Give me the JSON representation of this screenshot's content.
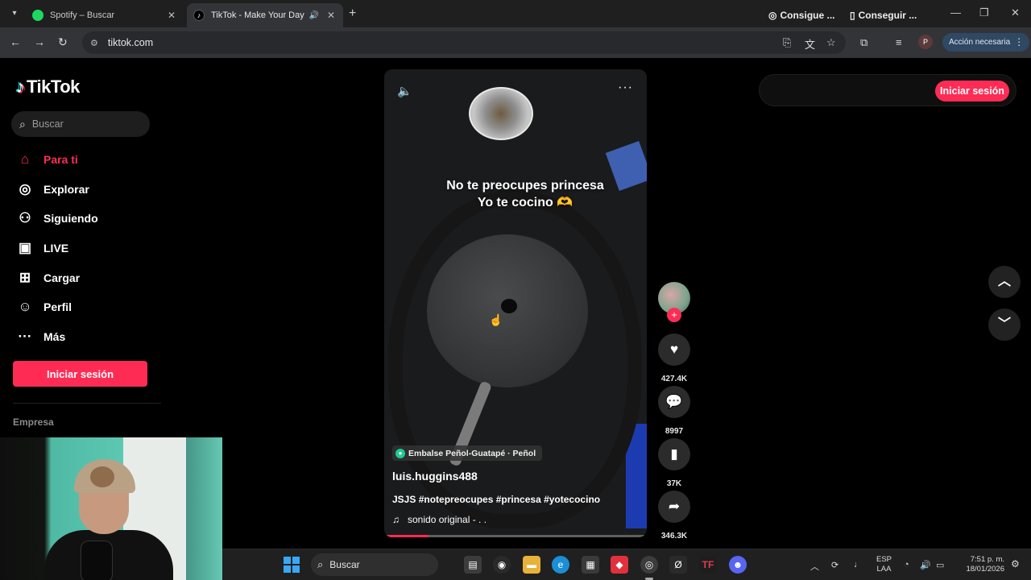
{
  "browser": {
    "tabs": [
      {
        "title": "Spotify – Buscar",
        "active": false
      },
      {
        "title": "TikTok - Make Your Day",
        "active": true,
        "audio": true
      }
    ],
    "url": "tiktok.com",
    "action_button": "Acción necesaria",
    "profile_initial": "P"
  },
  "sidebar": {
    "logo": "TikTok",
    "search_placeholder": "Buscar",
    "nav": [
      {
        "label": "Para ti",
        "icon": "home-icon",
        "active": true
      },
      {
        "label": "Explorar",
        "icon": "compass-icon"
      },
      {
        "label": "Siguiendo",
        "icon": "following-icon"
      },
      {
        "label": "LIVE",
        "icon": "live-icon"
      },
      {
        "label": "Cargar",
        "icon": "upload-icon"
      },
      {
        "label": "Perfil",
        "icon": "profile-icon"
      },
      {
        "label": "Más",
        "icon": "more-icon"
      }
    ],
    "login_label": "Iniciar sesión",
    "section_title": "Empresa"
  },
  "video": {
    "overlay_line1": "No te preocupes princesa",
    "overlay_line2": "Yo te cocino 🫶",
    "location": "Embalse Peñol-Guatapé · Peñol",
    "author": "luis.huggins488",
    "description": "JSJS #notepreocupes #princesa #yotecocino",
    "sound": "sonido original - . .",
    "progress_fraction": 0.17
  },
  "actions": {
    "likes": "427.4K",
    "comments": "8997",
    "saves": "37K",
    "shares": "346.3K"
  },
  "top_right": {
    "link1": "Consigue ...",
    "link2": "Conseguir ...",
    "login_label": "Iniciar sesión"
  },
  "taskbar": {
    "search_label": "Buscar",
    "lang_line1": "ESP",
    "lang_line2": "LAA",
    "time": "7:51 p. m.",
    "date": "18/01/2026"
  },
  "colors": {
    "accent": "#fe2c55",
    "page_bg": "#000000"
  }
}
